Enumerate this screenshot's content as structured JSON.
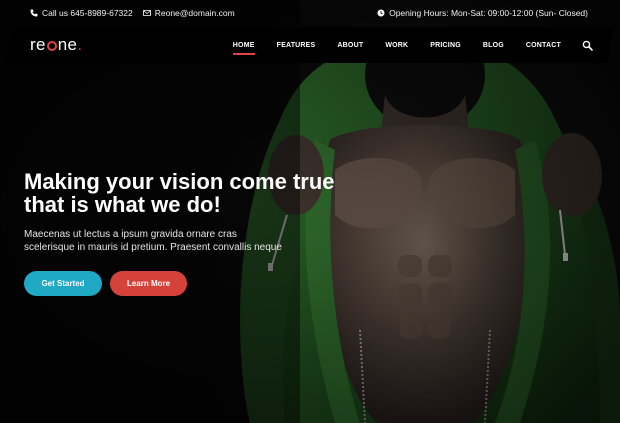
{
  "topbar": {
    "phone": "Call us 645-8989-67322",
    "email": "Reone@domain.com",
    "hours": "Opening Hours: Mon-Sat: 09:00-12:00 (Sun- Closed)"
  },
  "logo": {
    "prefix": "re",
    "suffix": "ne",
    "dot": "."
  },
  "nav": {
    "items": [
      "HOME",
      "FEATURES",
      "ABOUT",
      "WORK",
      "PRICING",
      "BLOG",
      "CONTACT"
    ],
    "active": "HOME"
  },
  "hero": {
    "headline_line1": "Making your vision come true",
    "headline_line2": "that is what we do!",
    "sub_line1": "Maecenas ut lectus a ipsum gravida ornare cras",
    "sub_line2": "scelerisque in mauris id pretium. Praesent convallis neque",
    "primary_button": "Get Started",
    "secondary_button": "Learn More"
  },
  "colors": {
    "accent_red": "#e0443f",
    "button_blue": "#1fa9c4",
    "button_red": "#d5423a",
    "hoodie_green": "#2d6b2b"
  },
  "icons": [
    "phone-icon",
    "envelope-icon",
    "clock-icon",
    "search-icon"
  ]
}
